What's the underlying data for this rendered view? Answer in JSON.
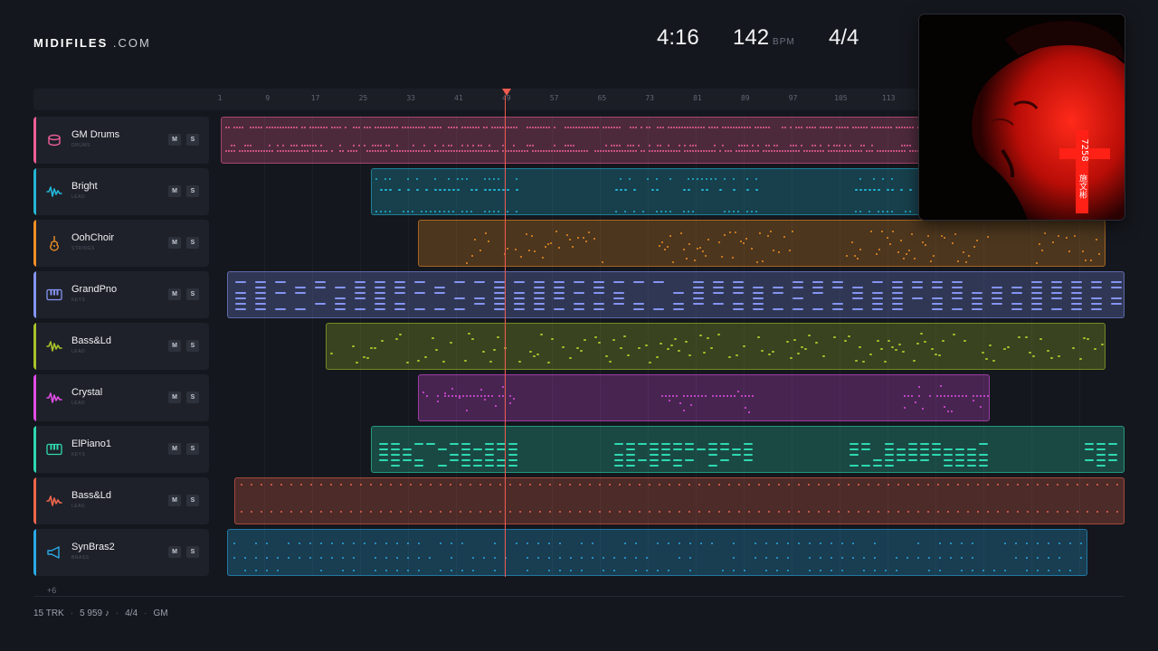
{
  "app": {
    "logo_bold": "MIDIFILES",
    "logo_light": ".COM"
  },
  "stats": {
    "time": "4:16",
    "bpm": "142",
    "bpm_label": "BPM",
    "signature": "4/4"
  },
  "ruler": {
    "ticks": [
      "1",
      "9",
      "17",
      "25",
      "33",
      "41",
      "49",
      "57",
      "65",
      "73",
      "81",
      "89",
      "97",
      "105",
      "113"
    ],
    "playhead_bar": 49
  },
  "tracks": [
    {
      "name": "GM Drums",
      "category": "DRUMS",
      "color": "#ee5f98",
      "icon": "drum-icon",
      "mute": "M",
      "solo": "S"
    },
    {
      "name": "Bright",
      "category": "LEAD",
      "color": "#24b4d6",
      "icon": "waveform-icon",
      "mute": "M",
      "solo": "S"
    },
    {
      "name": "OohChoir",
      "category": "STRINGS",
      "color": "#ef8f24",
      "icon": "violin-icon",
      "mute": "M",
      "solo": "S"
    },
    {
      "name": "GrandPno",
      "category": "KEYS",
      "color": "#8594f2",
      "icon": "piano-keys-icon",
      "mute": "M",
      "solo": "S"
    },
    {
      "name": "Bass&Ld",
      "category": "LEAD",
      "color": "#a7c22a",
      "icon": "waveform-icon",
      "mute": "M",
      "solo": "S"
    },
    {
      "name": "Crystal",
      "category": "LEAD",
      "color": "#e14ee6",
      "icon": "waveform-icon",
      "mute": "M",
      "solo": "S"
    },
    {
      "name": "ElPiano1",
      "category": "KEYS",
      "color": "#2fd8b1",
      "icon": "piano-keys-icon",
      "mute": "M",
      "solo": "S"
    },
    {
      "name": "Bass&Ld",
      "category": "LEAD",
      "color": "#f0664c",
      "icon": "waveform-icon",
      "mute": "M",
      "solo": "S"
    },
    {
      "name": "SynBras2",
      "category": "BRASS",
      "color": "#2aa9e6",
      "icon": "horn-icon",
      "mute": "M",
      "solo": "S"
    }
  ],
  "more_tracks": "+6",
  "footer": {
    "tracks": "15 TRK",
    "notes": "5 959 ♪",
    "signature": "4/4",
    "standard": "GM"
  },
  "album_art": {
    "text_vertical": "7258",
    "text_chinese": "施文彬"
  }
}
